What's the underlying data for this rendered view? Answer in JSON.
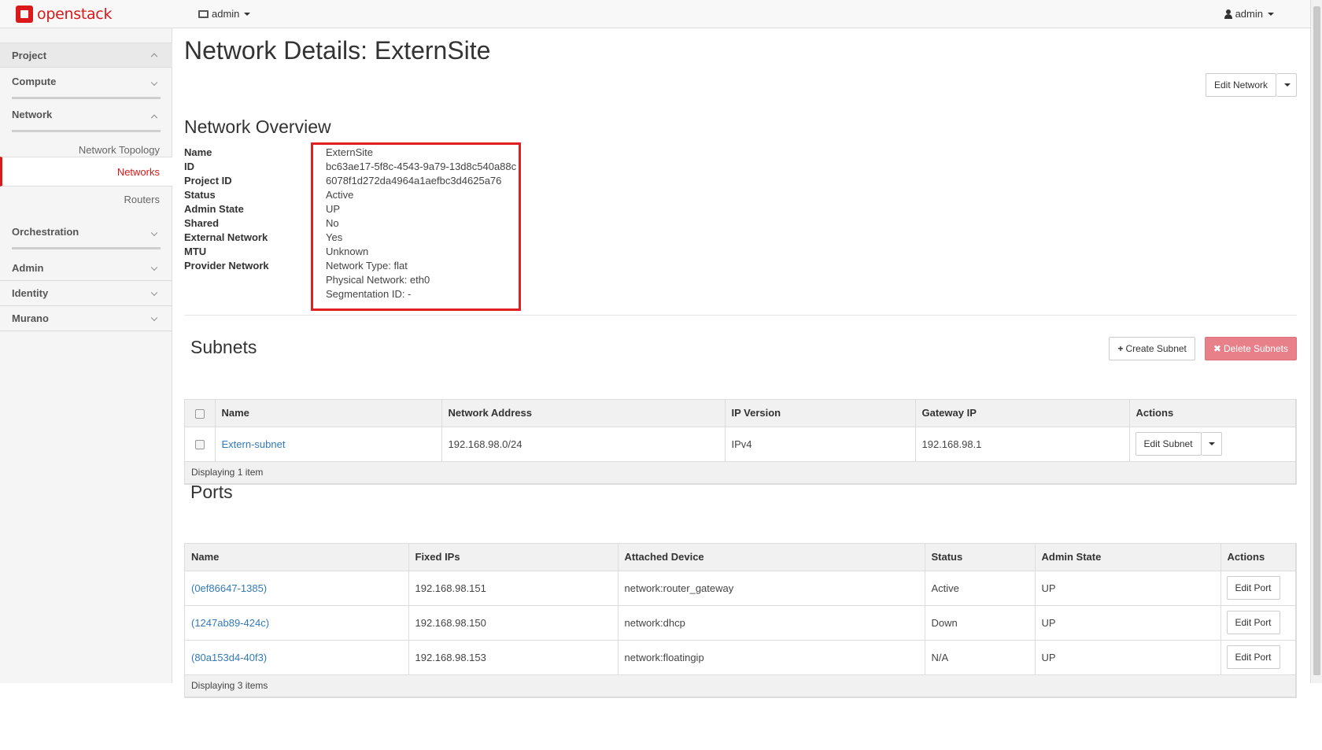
{
  "navbar": {
    "brand": "openstack",
    "project_selector": "admin",
    "user_menu": "admin"
  },
  "sidebar": {
    "project": "Project",
    "compute": "Compute",
    "network": "Network",
    "network_items": [
      "Network Topology",
      "Networks",
      "Routers"
    ],
    "orchestration": "Orchestration",
    "admin": "Admin",
    "identity": "Identity",
    "murano": "Murano"
  },
  "page": {
    "title": "Network Details: ExternSite",
    "edit_network": "Edit Network"
  },
  "overview": {
    "title": "Network Overview",
    "fields": [
      {
        "label": "Name",
        "value": "ExternSite"
      },
      {
        "label": "ID",
        "value": "bc63ae17-5f8c-4543-9a79-13d8c540a88c"
      },
      {
        "label": "Project ID",
        "value": "6078f1d272da4964a1aefbc3d4625a76"
      },
      {
        "label": "Status",
        "value": "Active"
      },
      {
        "label": "Admin State",
        "value": "UP"
      },
      {
        "label": "Shared",
        "value": "No"
      },
      {
        "label": "External Network",
        "value": "Yes"
      },
      {
        "label": "MTU",
        "value": "Unknown"
      },
      {
        "label": "Provider Network",
        "value": "Network Type: flat"
      },
      {
        "label": "",
        "value": "Physical Network: eth0"
      },
      {
        "label": "",
        "value": "Segmentation ID: -"
      }
    ]
  },
  "subnets": {
    "title": "Subnets",
    "create_button": "Create Subnet",
    "delete_button": "Delete Subnets",
    "columns": [
      "Name",
      "Network Address",
      "IP Version",
      "Gateway IP",
      "Actions"
    ],
    "rows": [
      {
        "name": "Extern-subnet",
        "network_address": "192.168.98.0/24",
        "ip_version": "IPv4",
        "gateway_ip": "192.168.98.1",
        "action": "Edit Subnet"
      }
    ],
    "footer": "Displaying 1 item"
  },
  "ports": {
    "title": "Ports",
    "columns": [
      "Name",
      "Fixed IPs",
      "Attached Device",
      "Status",
      "Admin State",
      "Actions"
    ],
    "rows": [
      {
        "name": "(0ef86647-1385)",
        "fixed_ips": "192.168.98.151",
        "attached_device": "network:router_gateway",
        "status": "Active",
        "admin_state": "UP",
        "action": "Edit Port"
      },
      {
        "name": "(1247ab89-424c)",
        "fixed_ips": "192.168.98.150",
        "attached_device": "network:dhcp",
        "status": "Down",
        "admin_state": "UP",
        "action": "Edit Port"
      },
      {
        "name": "(80a153d4-40f3)",
        "fixed_ips": "192.168.98.153",
        "attached_device": "network:floatingip",
        "status": "N/A",
        "admin_state": "UP",
        "action": "Edit Port"
      }
    ],
    "footer": "Displaying 3 items"
  },
  "colors": {
    "brand_red": "#da1a1a",
    "link_blue": "#337ab7",
    "danger_button": "#e8808a"
  }
}
